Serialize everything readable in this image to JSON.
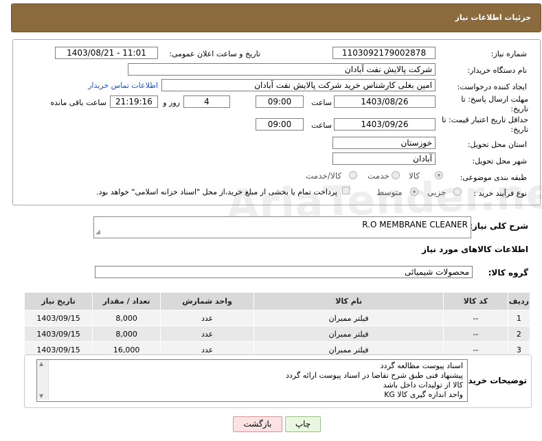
{
  "header": {
    "title": "جزئیات اطلاعات نیاز"
  },
  "form": {
    "need_number_label": "شماره نیاز:",
    "need_number": "1103092179002878",
    "announce_label": "تاریخ و ساعت اعلان عمومی:",
    "announce_value": "1403/08/21 - 11:01",
    "buyer_org_label": "نام دستگاه خریدار:",
    "buyer_org": "شرکت پالایش نفت آبادان",
    "creator_label": "ایجاد کننده درخواست:",
    "creator": "امین بغلی کارشناس خرید شرکت پالایش نفت آبادان",
    "contact_link": "اطلاعات تماس خریدار",
    "deadline_label": "مهلت ارسال پاسخ: تا تاریخ:",
    "deadline_date": "1403/08/26",
    "time_label": "ساعت",
    "deadline_time": "09:00",
    "days_value": "4",
    "days_label": "روز و",
    "remaining_time": "21:19:16",
    "remaining_label": "ساعت باقی مانده",
    "validity_label": "حداقل تاریخ اعتبار قیمت: تا تاریخ:",
    "validity_date": "1403/09/26",
    "validity_time": "09:00",
    "province_label": "استان محل تحویل:",
    "province": "خوزستان",
    "city_label": "شهر محل تحویل:",
    "city": "آبادان",
    "category_label": "طبقه بندی موضوعی:",
    "category_options": [
      "کالا",
      "خدمت",
      "کالا/خدمت"
    ],
    "process_label": "نوع فرآیند خرید :",
    "process_options": [
      "جزیی",
      "متوسط"
    ],
    "payment_note": "پرداخت تمام یا بخشی از مبلغ خرید،از محل \"اسناد خزانه اسلامی\" خواهد بود."
  },
  "summary": {
    "label": "شرح کلی نیاز:",
    "value": "R.O MEMBRANE CLEANER"
  },
  "goods_section_title": "اطلاعات کالاهای مورد نیاز",
  "goods_group": {
    "label": "گروه کالا:",
    "value": "محصولات شیمیائی"
  },
  "table": {
    "headers": [
      "ردیف",
      "کد کالا",
      "نام کالا",
      "واحد شمارش",
      "تعداد / مقدار",
      "تاریخ نیاز"
    ],
    "rows": [
      [
        "1",
        "--",
        "فیلتر ممبران",
        "عدد",
        "8,000",
        "1403/09/15"
      ],
      [
        "2",
        "--",
        "فیلتر ممبران",
        "عدد",
        "8,000",
        "1403/09/15"
      ],
      [
        "3",
        "--",
        "فیلتر ممبران",
        "عدد",
        "16,000",
        "1403/09/15"
      ]
    ]
  },
  "notes": {
    "label": "توضیحات خریدار:",
    "lines": [
      "اسناد پیوست مطالعه گردد",
      "پیشنهاد فنی طبق شرح تقاضا در اسناد پیوست ارائه گردد",
      "کالا از تولیدات داخل باشد",
      "واحد اندازه گیری کالا KG"
    ]
  },
  "buttons": {
    "print": "چاپ",
    "back": "بازگشت"
  },
  "watermark": "AriaTender.neT"
}
